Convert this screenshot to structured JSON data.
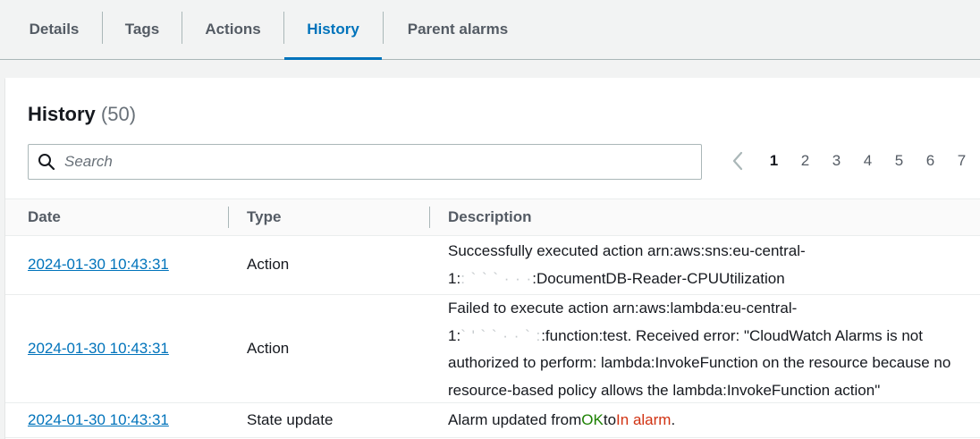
{
  "tabs": [
    {
      "label": "Details",
      "active": false
    },
    {
      "label": "Tags",
      "active": false
    },
    {
      "label": "Actions",
      "active": false
    },
    {
      "label": "History",
      "active": true
    },
    {
      "label": "Parent alarms",
      "active": false
    }
  ],
  "history": {
    "title": "History",
    "count": "(50)",
    "search_placeholder": "Search",
    "pagination": {
      "prev_icon": "chevron-left-icon",
      "pages": [
        "1",
        "2",
        "3",
        "4",
        "5",
        "6",
        "7"
      ],
      "current": "1"
    },
    "columns": {
      "date": "Date",
      "type": "Type",
      "description": "Description"
    },
    "rows": [
      {
        "date": "2024-01-30 10:43:31",
        "type": "Action",
        "desc_line1": "Successfully executed action arn:aws:sns:eu-central-",
        "desc_line2_prefix": "1:",
        "desc_line2_redacted": ": ` ` ` ·  ·  ·",
        "desc_line2_suffix": ":DocumentDB-Reader-CPUUtilization"
      },
      {
        "date": "2024-01-30 10:43:31",
        "type": "Action",
        "desc_line1": "Failed to execute action arn:aws:lambda:eu-central-",
        "desc_line2_prefix": "1:",
        "desc_line2_redacted": "` ' ` ` · · ` :",
        "desc_line2_suffix": ":function:test. Received error: \"CloudWatch Alarms is not",
        "desc_line3": "authorized to perform: lambda:InvokeFunction on the resource because no",
        "desc_line4": "resource-based policy allows the lambda:InvokeFunction action\""
      },
      {
        "date": "2024-01-30 10:43:31",
        "type": "State update",
        "desc_prefix": "Alarm updated from",
        "desc_from": "OK",
        "desc_mid": "to",
        "desc_to": "In alarm",
        "desc_end": "."
      }
    ]
  },
  "colors": {
    "link": "#0073bb",
    "ok": "#1d8102",
    "alarm": "#d13212"
  }
}
